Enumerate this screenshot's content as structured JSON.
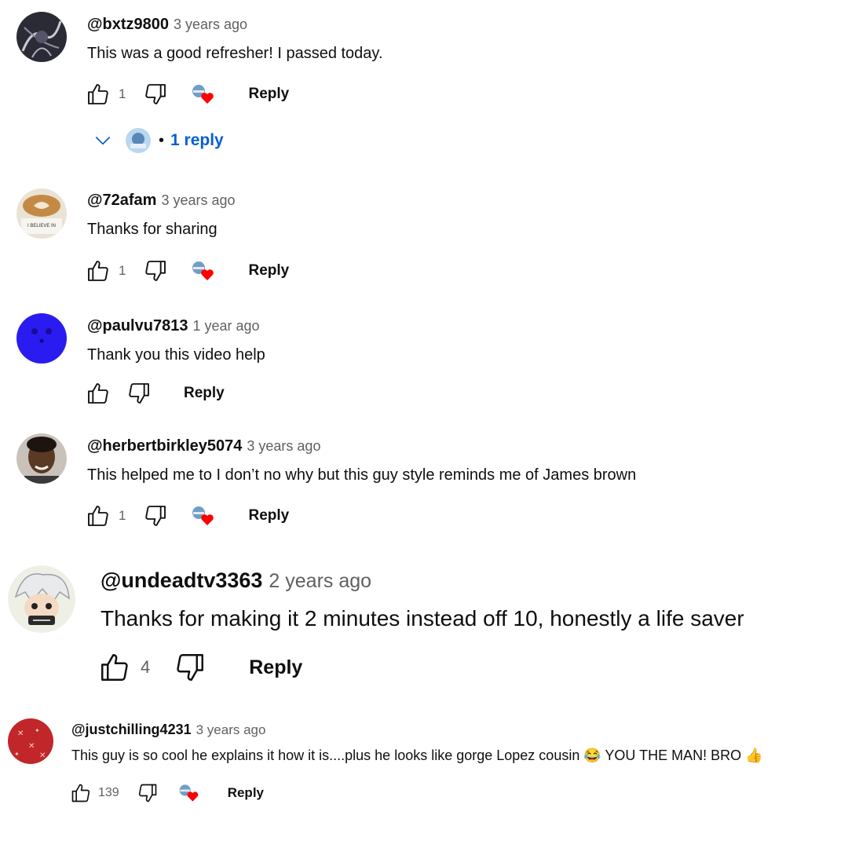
{
  "colors": {
    "accent": "#065fd4",
    "muted": "#606060",
    "heart": "#ff0000"
  },
  "comments": [
    {
      "author": "@bxtz9800",
      "time": "3 years ago",
      "text": "This was a good refresher! I passed today.",
      "likes": "1",
      "reply_label": "Reply",
      "hearted": true,
      "replies": {
        "label": "1 reply",
        "bullet": "•"
      }
    },
    {
      "author": "@72afam",
      "time": "3 years ago",
      "text": "Thanks for sharing",
      "likes": "1",
      "reply_label": "Reply",
      "hearted": true,
      "avatar_text": "I BELIEVE IN"
    },
    {
      "author": "@paulvu7813",
      "time": "1 year ago",
      "text": "Thank you this video help",
      "likes": "",
      "reply_label": "Reply",
      "hearted": false
    },
    {
      "author": "@herbertbirkley5074",
      "time": "3 years ago",
      "text": "This helped me to I don’t no why but this guy style reminds me of James brown",
      "likes": "1",
      "reply_label": "Reply",
      "hearted": true
    },
    {
      "author": "@undeadtv3363",
      "time": "2 years ago",
      "text": "Thanks for making it 2 minutes instead off 10, honestly a life saver",
      "likes": "4",
      "reply_label": "Reply",
      "hearted": false
    },
    {
      "author": "@justchilling4231",
      "time": "3 years ago",
      "text": "This guy is so cool he explains it how it is....plus he looks like gorge Lopez cousin 😂 YOU THE MAN! BRO 👍",
      "likes": "139",
      "reply_label": "Reply",
      "hearted": true
    }
  ],
  "icons": {
    "like": "thumbs-up-icon",
    "dislike": "thumbs-down-icon",
    "heart": "creator-heart-icon",
    "expand": "chevron-down-icon"
  }
}
